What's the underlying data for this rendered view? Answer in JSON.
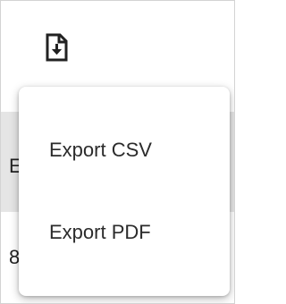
{
  "toolbar": {
    "export_icon": "file-download-icon"
  },
  "table": {
    "header_cell_fragment": "E",
    "row_cell_fragment": "8"
  },
  "export_menu": {
    "items": [
      {
        "label": "Export CSV"
      },
      {
        "label": "Export PDF"
      }
    ]
  },
  "colors": {
    "icon": "#222222",
    "header_background": "#e5e5e5",
    "menu_background": "#ffffff",
    "frame_border": "#d3d3d3"
  }
}
